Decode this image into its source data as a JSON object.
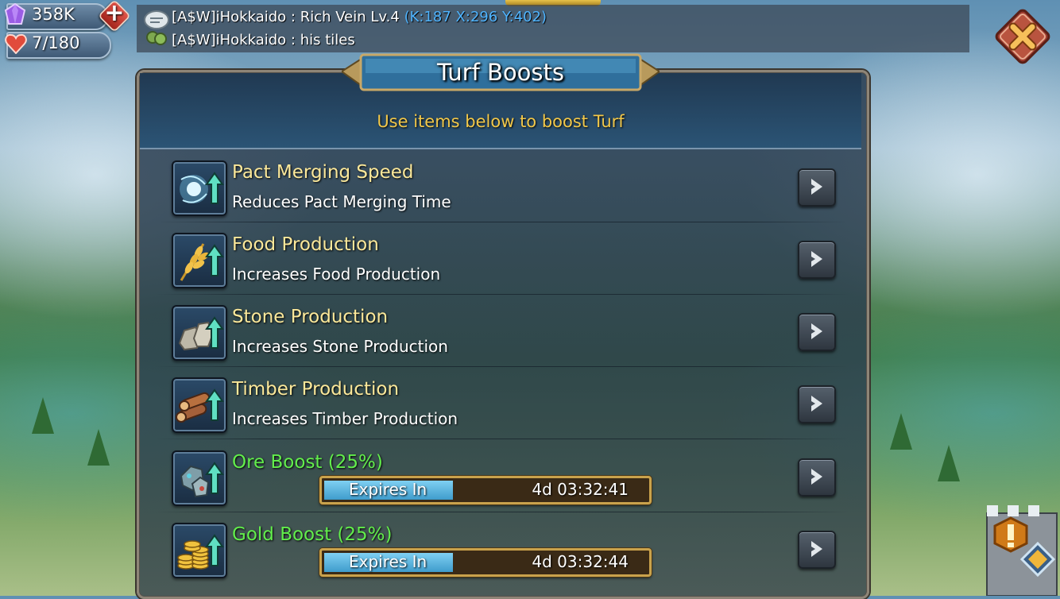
{
  "hud": {
    "gems": "358K",
    "stamina": "7/180"
  },
  "chat": {
    "lines": [
      {
        "speaker": "[A$W]iHokkaido",
        "separator": ":",
        "message": "Rich Vein Lv.4",
        "coords": "(K:187 X:296 Y:402)"
      },
      {
        "speaker": "[A$W]iHokkaido",
        "separator": ":",
        "message": "his tiles",
        "coords": ""
      }
    ]
  },
  "panel": {
    "title": "Turf Boosts",
    "subtitle": "Use items below to boost Turf"
  },
  "boosts": [
    {
      "title": "Pact Merging Speed",
      "description": "Reduces Pact Merging Time",
      "active": false,
      "icon": "pact-merging-icon"
    },
    {
      "title": "Food Production",
      "description": "Increases Food Production",
      "active": false,
      "icon": "wheat-icon"
    },
    {
      "title": "Stone Production",
      "description": "Increases Stone Production",
      "active": false,
      "icon": "stone-icon"
    },
    {
      "title": "Timber Production",
      "description": "Increases Timber Production",
      "active": false,
      "icon": "timber-icon"
    },
    {
      "title": "Ore Boost (25%)",
      "active": true,
      "icon": "ore-icon",
      "timer_label": "Expires In",
      "timer_value": "4d 03:32:41",
      "timer_progress": 0.4
    },
    {
      "title": "Gold Boost (25%)",
      "active": true,
      "icon": "gold-icon",
      "timer_label": "Expires In",
      "timer_value": "4d 03:32:44",
      "timer_progress": 0.4
    }
  ],
  "colors": {
    "title_text": "#fbe89a",
    "active_text": "#62ee4c",
    "subtitle_text": "#f2c84a",
    "chat_coords": "#4fb4ff",
    "close_button": "#d9783a"
  }
}
